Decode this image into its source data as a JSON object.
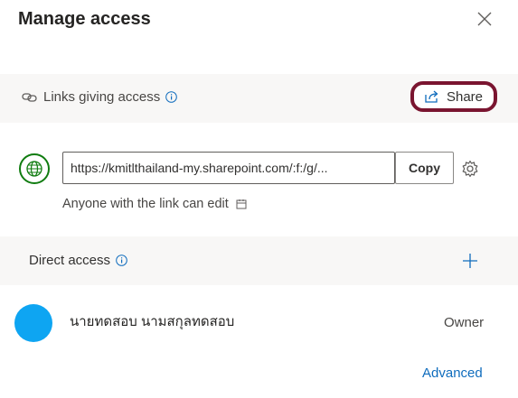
{
  "dialog": {
    "title": "Manage access"
  },
  "links_section": {
    "label": "Links giving access",
    "share_label": "Share"
  },
  "link": {
    "url": "https://kmitlthailand-my.sharepoint.com/:f:/g/...",
    "copy_label": "Copy",
    "permission_text": "Anyone with the link can edit"
  },
  "direct_access": {
    "label": "Direct access",
    "users": [
      {
        "name": "นายทดสอบ นามสกุลทดสอบ",
        "role": "Owner"
      }
    ]
  },
  "footer": {
    "advanced_label": "Advanced"
  },
  "colors": {
    "accent": "#0f6cbd",
    "highlight_border": "#7a1530",
    "globe": "#107c10",
    "avatar": "#0ea5f2"
  },
  "icons": [
    "close-icon",
    "link-icon",
    "info-icon",
    "share-icon",
    "globe-icon",
    "gear-icon",
    "calendar-icon",
    "plus-icon"
  ]
}
